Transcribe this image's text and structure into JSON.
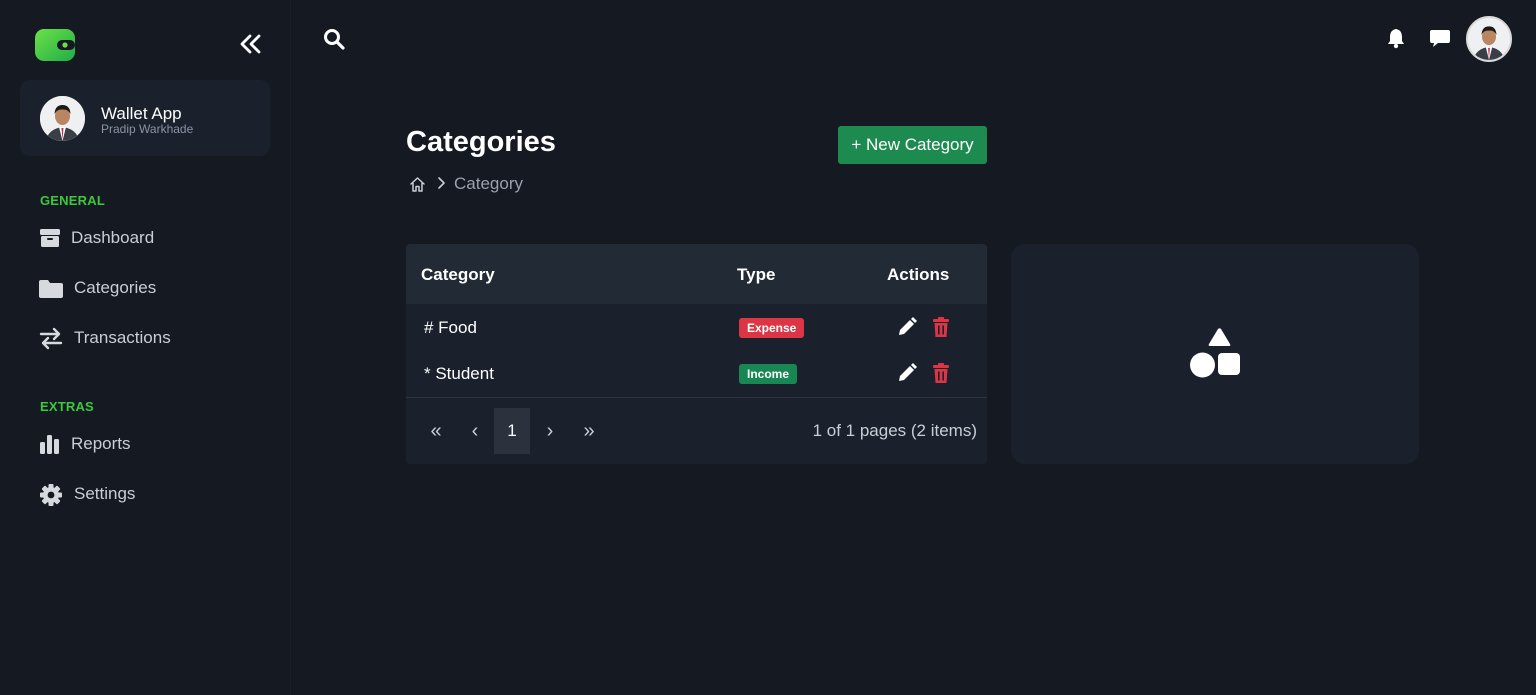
{
  "sidebar": {
    "profile": {
      "name": "Wallet App",
      "subtitle": "Pradip Warkhade"
    },
    "sections": [
      {
        "title": "GENERAL",
        "items": [
          {
            "label": "Dashboard",
            "icon": "box-icon"
          },
          {
            "label": "Categories",
            "icon": "folder-icon"
          },
          {
            "label": "Transactions",
            "icon": "transfer-icon"
          }
        ]
      },
      {
        "title": "EXTRAS",
        "items": [
          {
            "label": "Reports",
            "icon": "bar-chart-icon"
          },
          {
            "label": "Settings",
            "icon": "gear-icon"
          }
        ]
      }
    ]
  },
  "page": {
    "title": "Categories",
    "breadcrumb": "Category",
    "new_button": "+ New Category"
  },
  "table": {
    "columns": [
      "Category",
      "Type",
      "Actions"
    ],
    "rows": [
      {
        "category": "# Food",
        "type": "Expense"
      },
      {
        "category": "* Student",
        "type": "Income"
      }
    ],
    "pagination": {
      "first": "«",
      "prev": "‹",
      "current": "1",
      "next": "›",
      "last": "»",
      "info": "1 of 1 pages (2 items)"
    }
  },
  "colors": {
    "accent_green": "#1d8a4f",
    "section_green": "#3cc93a",
    "expense": "#dc3545",
    "income": "#198754",
    "background": "#141922",
    "card": "#1b212c"
  }
}
